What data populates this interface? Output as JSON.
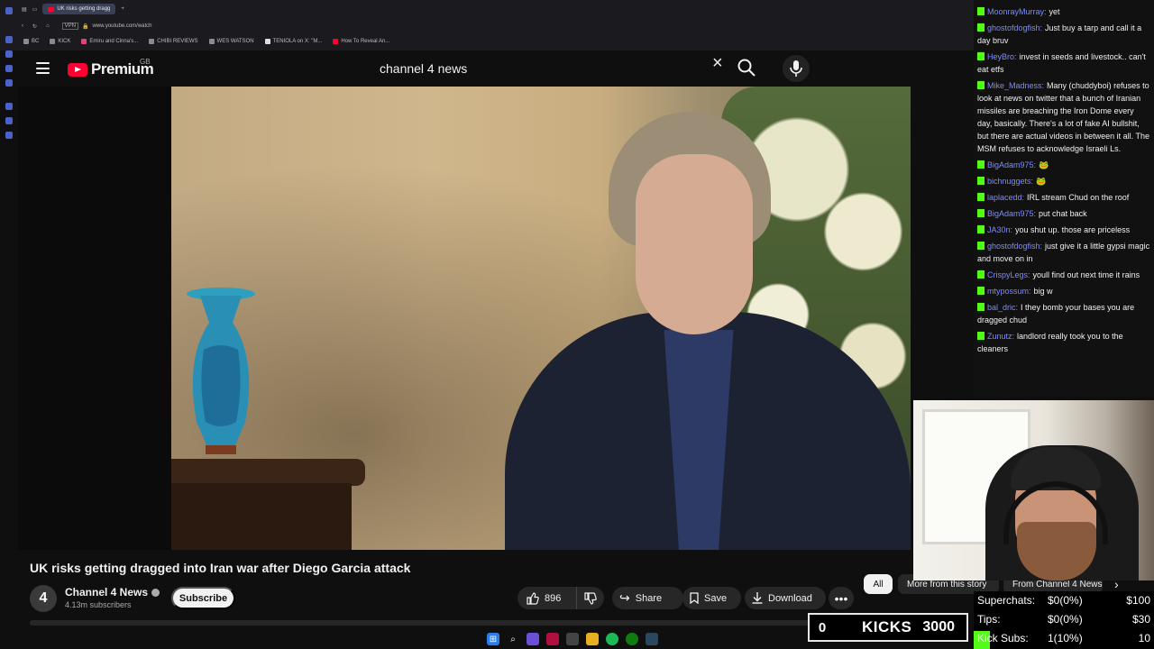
{
  "browser": {
    "tab_title": "UK risks getting dragg",
    "url": "www.youtube.com/watch",
    "bookmarks": [
      "BC",
      "KICK",
      "Emiru and Cinna's...",
      "CHIBI REVIEWS",
      "WES WATSON",
      "TENIOLA on X: \"M...",
      "How To Reveal An..."
    ]
  },
  "youtube": {
    "logo_text": "Premium",
    "region": "GB",
    "search_query": "channel 4 news"
  },
  "video": {
    "title": "UK risks getting dragged into Iran war after Diego Garcia attack",
    "channel_avatar_text": "4",
    "channel_name": "Channel 4 News",
    "subscribers": "4.13m subscribers",
    "subscribe_label": "Subscribe",
    "like_count": "896",
    "share_label": "Share",
    "save_label": "Save",
    "download_label": "Download",
    "more_label": "•••"
  },
  "chips": {
    "all": "All",
    "story": "More from this story",
    "channel": "From Channel 4 News"
  },
  "chat": [
    {
      "user": "MoonrayMurray:",
      "text": "yet"
    },
    {
      "user": "ghostofdogfish:",
      "text": "Just buy a tarp and call it a day bruv"
    },
    {
      "user": "HeyBro:",
      "text": "invest in seeds and livestock.. can't eat etfs"
    },
    {
      "user": "Mike_Madness:",
      "text": "Many (chuddyboi) refuses to look at news on twitter that a bunch of Iranian missiles are breaching the Iron Dome every day, basically. There's a lot of fake AI bullshit, but there are actual videos in between it all. The MSM refuses to acknowledge Israeli Ls."
    },
    {
      "user": "BigAdam975:",
      "text": "🐸"
    },
    {
      "user": "bichnuggets:",
      "text": "🐸"
    },
    {
      "user": "laplacedd:",
      "text": "IRL stream Chud on the roof"
    },
    {
      "user": "BigAdam975:",
      "text": "put chat back"
    },
    {
      "user": "JA30n:",
      "text": "you shut up. those are priceless"
    },
    {
      "user": "ghostofdogfish:",
      "text": "just give it a little gypsi magic and move on in"
    },
    {
      "user": "CrispyLegs:",
      "text": "youll find out next time it rains"
    },
    {
      "user": "mtypossum:",
      "text": "big w"
    },
    {
      "user": "bal_dric:",
      "text": "I they bomb your bases you are dragged chud"
    },
    {
      "user": "Zunutz:",
      "text": "landlord really took you to the cleaners"
    }
  ],
  "stats": {
    "superchats": {
      "label": "Superchats:",
      "value": "$0(0%)",
      "goal": "$100"
    },
    "tips": {
      "label": "Tips:",
      "value": "$0(0%)",
      "goal": "$30"
    },
    "kick_subs": {
      "label": "Kick Subs:",
      "value": "1(10%)",
      "goal": "10"
    },
    "kicks_count": "0",
    "kicks_label": "KICKS",
    "kicks_goal": "3000"
  },
  "colors": {
    "kick_green": "#53fc18",
    "youtube_red": "#ff0033",
    "chat_username": "#7c8cff"
  }
}
